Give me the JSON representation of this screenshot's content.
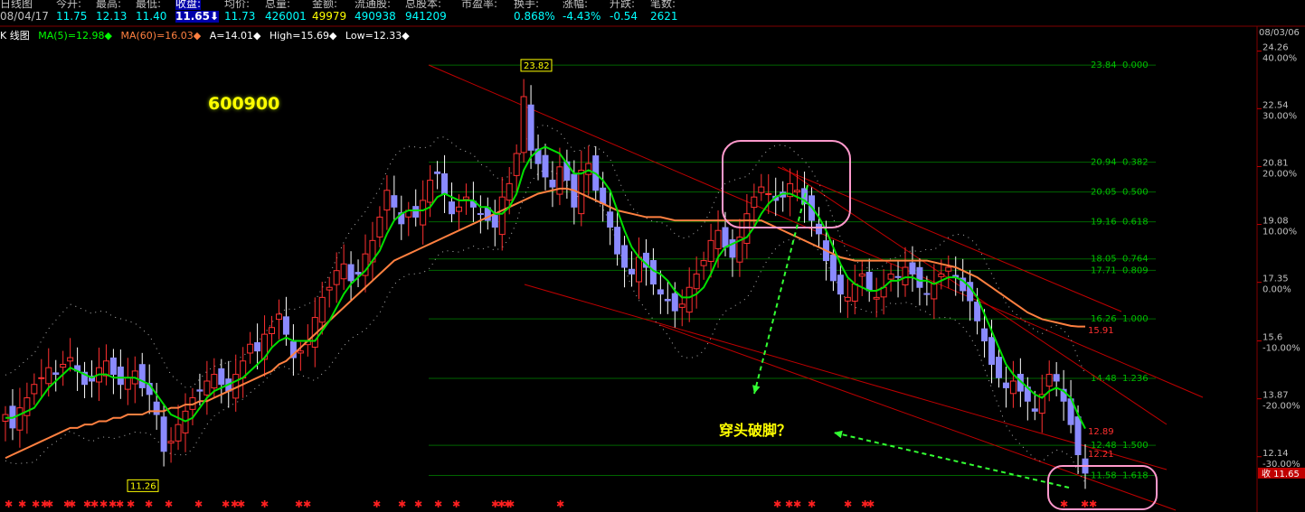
{
  "header": {
    "fields": [
      {
        "label": "日线图",
        "value": "08/04/17",
        "color": "#c0c0c0"
      },
      {
        "label": "今开:",
        "value": "11.75",
        "color": "#00ffff"
      },
      {
        "label": "最高:",
        "value": "12.13",
        "color": "#00ffff"
      },
      {
        "label": "最低:",
        "value": "11.40",
        "color": "#00ffff"
      },
      {
        "label": "收盘:",
        "value": "11.65⬇",
        "color": "#ffffff",
        "highlight": true
      },
      {
        "label": "均价:",
        "value": "11.73",
        "color": "#00ffff"
      },
      {
        "label": "总量:",
        "value": "426001",
        "color": "#00ffff"
      },
      {
        "label": "金额:",
        "value": "49979",
        "color": "#ffff00"
      },
      {
        "label": "流通股:",
        "value": "490938",
        "color": "#00ffff"
      },
      {
        "label": "总股本:",
        "value": "941209",
        "color": "#00ffff"
      },
      {
        "label": "市盈率:",
        "value": "",
        "color": "#00ffff"
      },
      {
        "label": "换手:",
        "value": "0.868%",
        "color": "#00ffff"
      },
      {
        "label": "涨幅:",
        "value": "-4.43%",
        "color": "#00ffff"
      },
      {
        "label": "升跌:",
        "value": "-0.54",
        "color": "#00ffff"
      },
      {
        "label": "笔数:",
        "value": "2621",
        "color": "#00ffff"
      }
    ]
  },
  "legend": {
    "chart_name": "K 线图",
    "ma5": "MA(5)=12.98◆",
    "ma60": "MA(60)=16.03◆",
    "a": "A=14.01◆",
    "high": "High=15.69◆",
    "low": "Low=12.33◆",
    "colors": {
      "ma5": "#00ff00",
      "ma60": "#ff8040",
      "white": "#ffffff"
    }
  },
  "stock_code": "600900",
  "annotation": "穿头破脚？",
  "axis_date": "08/03/06",
  "chart_data": {
    "type": "candlestick",
    "y_axis_labels": [
      {
        "price": "24.26",
        "pct": "40.00%"
      },
      {
        "price": "22.54",
        "pct": "30.00%"
      },
      {
        "price": "20.81",
        "pct": "20.00%"
      },
      {
        "price": "19.08",
        "pct": "10.00%"
      },
      {
        "price": "17.35",
        "pct": "0.00%"
      },
      {
        "price": "15.6",
        "pct": "-10.00%"
      },
      {
        "price": "13.87",
        "pct": "-20.00%"
      },
      {
        "price": "12.14",
        "pct": "-30.00%"
      }
    ],
    "ylim": [
      11.0,
      24.6
    ],
    "fib_levels": [
      {
        "price": "23.84",
        "ratio": "0.000"
      },
      {
        "price": "20.94",
        "ratio": "0.382"
      },
      {
        "price": "20.05",
        "ratio": "0.500"
      },
      {
        "price": "19.16",
        "ratio": "0.618"
      },
      {
        "price": "18.05",
        "ratio": "0.764"
      },
      {
        "price": "17.71",
        "ratio": "0.809"
      },
      {
        "price": "16.26",
        "ratio": "1.000"
      },
      {
        "price": "14.48",
        "ratio": "1.236"
      },
      {
        "price": "12.48",
        "ratio": "1.500"
      },
      {
        "price": "11.58",
        "ratio": "1.618"
      }
    ],
    "marks": [
      {
        "text": "23.82",
        "price": 23.82
      },
      {
        "text": "11.26",
        "price": 11.26
      },
      {
        "text": "15.91",
        "price": 15.91
      },
      {
        "text": "12.89",
        "price": 12.89
      },
      {
        "text": "12.21",
        "price": 12.21
      }
    ],
    "close_tag": "收 11.65",
    "closes": [
      13.4,
      13.0,
      13.6,
      13.9,
      14.3,
      14.5,
      14.8,
      14.6,
      14.9,
      15.1,
      14.7,
      14.3,
      14.4,
      14.8,
      15.0,
      14.6,
      14.3,
      14.5,
      14.7,
      14.2,
      14.0,
      13.4,
      12.3,
      12.6,
      13.1,
      13.5,
      13.9,
      14.1,
      14.4,
      14.6,
      14.3,
      14.1,
      14.6,
      15.0,
      15.5,
      15.3,
      15.8,
      16.0,
      16.4,
      15.8,
      15.1,
      15.3,
      15.6,
      16.3,
      16.9,
      17.2,
      17.7,
      17.9,
      17.4,
      17.6,
      18.2,
      18.6,
      19.3,
      20.1,
      19.6,
      19.1,
      19.5,
      19.3,
      19.8,
      20.4,
      20.6,
      20.0,
      19.4,
      19.6,
      19.9,
      19.6,
      19.4,
      19.2,
      19.0,
      19.9,
      20.3,
      21.2,
      22.9,
      21.3,
      20.9,
      20.5,
      20.2,
      20.8,
      20.4,
      19.6,
      20.7,
      20.9,
      20.1,
      19.7,
      19.0,
      18.2,
      17.8,
      17.6,
      18.1,
      17.8,
      17.3,
      17.0,
      16.8,
      16.5,
      16.7,
      17.2,
      17.6,
      18.0,
      18.6,
      18.9,
      18.4,
      18.1,
      18.7,
      19.4,
      19.9,
      20.2,
      20.0,
      19.8,
      19.9,
      20.3,
      20.1,
      19.7,
      19.2,
      18.8,
      18.0,
      17.4,
      17.0,
      16.9,
      17.3,
      17.6,
      17.1,
      16.9,
      17.2,
      17.6,
      17.5,
      17.8,
      17.6,
      17.2,
      17.0,
      17.3,
      17.6,
      17.8,
      17.5,
      17.1,
      16.8,
      16.2,
      15.6,
      14.9,
      14.5,
      14.2,
      14.4,
      14.1,
      13.8,
      13.5,
      14.0,
      14.6,
      14.4,
      13.8,
      13.1,
      12.2,
      11.65
    ],
    "ma5": [
      13.3,
      13.3,
      13.4,
      13.5,
      13.6,
      13.9,
      14.2,
      14.4,
      14.6,
      14.8,
      14.7,
      14.6,
      14.5,
      14.6,
      14.6,
      14.5,
      14.5,
      14.5,
      14.5,
      14.4,
      14.3,
      14.0,
      13.7,
      13.4,
      13.3,
      13.2,
      13.3,
      13.6,
      13.9,
      14.1,
      14.2,
      14.3,
      14.4,
      14.5,
      14.7,
      14.9,
      15.1,
      15.4,
      15.6,
      15.7,
      15.6,
      15.6,
      15.6,
      15.6,
      15.9,
      16.2,
      16.6,
      17.0,
      17.3,
      17.5,
      17.7,
      18.0,
      18.3,
      18.8,
      19.2,
      19.4,
      19.5,
      19.5,
      19.5,
      19.6,
      19.9,
      20.0,
      19.9,
      19.8,
      19.8,
      19.8,
      19.6,
      19.6,
      19.4,
      19.4,
      19.6,
      20.0,
      20.7,
      21.1,
      21.3,
      21.4,
      21.3,
      21.2,
      20.9,
      20.6,
      20.6,
      20.7,
      20.6,
      20.4,
      20.1,
      19.5,
      18.9,
      18.4,
      18.1,
      17.9,
      17.7,
      17.6,
      17.4,
      17.1,
      16.9,
      16.9,
      17.0,
      17.2,
      17.6,
      18.1,
      18.4,
      18.5,
      18.6,
      18.7,
      19.0,
      19.4,
      19.7,
      19.9,
      20.0,
      20.0,
      19.9,
      19.8,
      19.6,
      19.3,
      18.9,
      18.4,
      17.9,
      17.5,
      17.3,
      17.2,
      17.1,
      17.1,
      17.2,
      17.4,
      17.4,
      17.5,
      17.5,
      17.4,
      17.4,
      17.3,
      17.4,
      17.5,
      17.5,
      17.4,
      17.2,
      16.9,
      16.4,
      15.9,
      15.4,
      14.9,
      14.6,
      14.4,
      14.2,
      14.0,
      13.9,
      14.1,
      14.2,
      14.1,
      13.9,
      13.4,
      12.98
    ],
    "ma60": [
      12.1,
      12.2,
      12.3,
      12.4,
      12.5,
      12.6,
      12.7,
      12.8,
      12.9,
      13.0,
      13.0,
      13.1,
      13.1,
      13.2,
      13.2,
      13.3,
      13.3,
      13.4,
      13.4,
      13.4,
      13.5,
      13.5,
      13.5,
      13.6,
      13.6,
      13.7,
      13.7,
      13.8,
      13.8,
      13.9,
      14.0,
      14.1,
      14.2,
      14.3,
      14.4,
      14.5,
      14.6,
      14.7,
      14.9,
      15.0,
      15.2,
      15.4,
      15.6,
      15.8,
      16.0,
      16.2,
      16.4,
      16.6,
      16.8,
      17.0,
      17.2,
      17.4,
      17.6,
      17.8,
      18.0,
      18.1,
      18.2,
      18.3,
      18.4,
      18.5,
      18.6,
      18.7,
      18.8,
      18.9,
      19.0,
      19.1,
      19.2,
      19.3,
      19.4,
      19.5,
      19.6,
      19.7,
      19.8,
      19.9,
      20.0,
      20.05,
      20.1,
      20.15,
      20.15,
      20.1,
      20.0,
      19.9,
      19.8,
      19.7,
      19.6,
      19.5,
      19.45,
      19.4,
      19.35,
      19.3,
      19.3,
      19.3,
      19.25,
      19.2,
      19.2,
      19.2,
      19.2,
      19.2,
      19.2,
      19.2,
      19.2,
      19.2,
      19.2,
      19.2,
      19.2,
      19.2,
      19.1,
      19.0,
      18.9,
      18.8,
      18.7,
      18.6,
      18.5,
      18.4,
      18.3,
      18.2,
      18.1,
      18.05,
      18.0,
      18.0,
      18.0,
      18.0,
      18.0,
      18.0,
      18.0,
      18.0,
      18.0,
      18.0,
      18.0,
      17.95,
      17.9,
      17.85,
      17.8,
      17.7,
      17.6,
      17.5,
      17.35,
      17.2,
      17.05,
      16.9,
      16.75,
      16.6,
      16.45,
      16.35,
      16.25,
      16.2,
      16.15,
      16.1,
      16.05,
      16.03,
      16.03
    ]
  }
}
